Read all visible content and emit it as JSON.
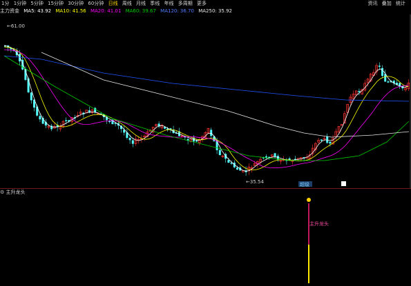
{
  "toolbar": {
    "items": [
      "1分",
      "1分钟",
      "5分钟",
      "15分钟",
      "30分钟",
      "60分钟",
      "日线",
      "周线",
      "月线",
      "季线",
      "年线",
      "多周期",
      "更多"
    ],
    "right": [
      "资讯",
      "叠加",
      "统计"
    ]
  },
  "legend": {
    "name": "主力资金",
    "ma5": "MA5: 43.92",
    "ma10": "MA10: 41.56",
    "ma20": "MA20: 41.01",
    "ma60": "MA60: 39.67",
    "ma120": "MA120: 36.70",
    "ma250": "MA250: 35.92"
  },
  "chart": {
    "high_label": "61.00",
    "low_label": "35.54",
    "marker_text": "超级",
    "indicator_title": "主升龙头",
    "indicator_text": "主升龙头"
  },
  "colors": {
    "up": "#ff3232",
    "down": "#54ffff",
    "ma5": "#ffffff",
    "ma10": "#ffff00",
    "ma20": "#ff00ff",
    "ma60": "#00cc00",
    "ma120": "#2255ff",
    "ma250": "#e8e8e8"
  }
}
